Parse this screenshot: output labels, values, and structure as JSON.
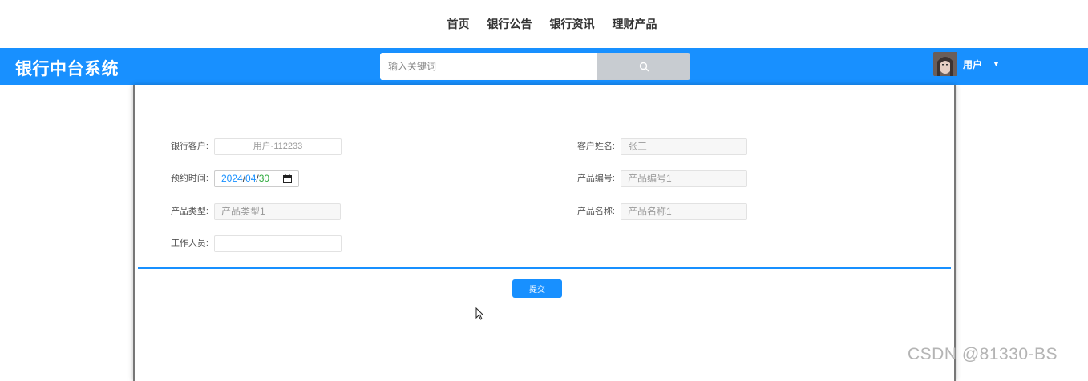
{
  "topnav": {
    "items": [
      "首页",
      "银行公告",
      "银行资讯",
      "理财产品"
    ]
  },
  "header": {
    "brand": "银行中台系统",
    "search_placeholder": "输入关键词",
    "search_icon": "search-icon",
    "user_name": "用户",
    "user_menu_icon": "caret-down-icon"
  },
  "form": {
    "customer": {
      "label": "银行客户:",
      "value": "用户-112233"
    },
    "customer_name": {
      "label": "客户姓名:",
      "value": "张三"
    },
    "appointment_time": {
      "label": "预约时间:",
      "year": "2024",
      "month": "04",
      "day": "30",
      "icon": "calendar-icon"
    },
    "product_code": {
      "label": "产品编号:",
      "value": "产品编号1"
    },
    "product_type": {
      "label": "产品类型:",
      "value": "产品类型1"
    },
    "product_name": {
      "label": "产品名称:",
      "value": "产品名称1"
    },
    "staff": {
      "label": "工作人员:",
      "value": ""
    },
    "submit_label": "提交"
  },
  "watermark": "CSDN @81330-BS",
  "colors": {
    "primary": "#1890ff",
    "search_button": "#c8ccd1",
    "date_year": "#1890ff",
    "date_month": "#1890ff",
    "date_day": "#2eaa3d"
  }
}
